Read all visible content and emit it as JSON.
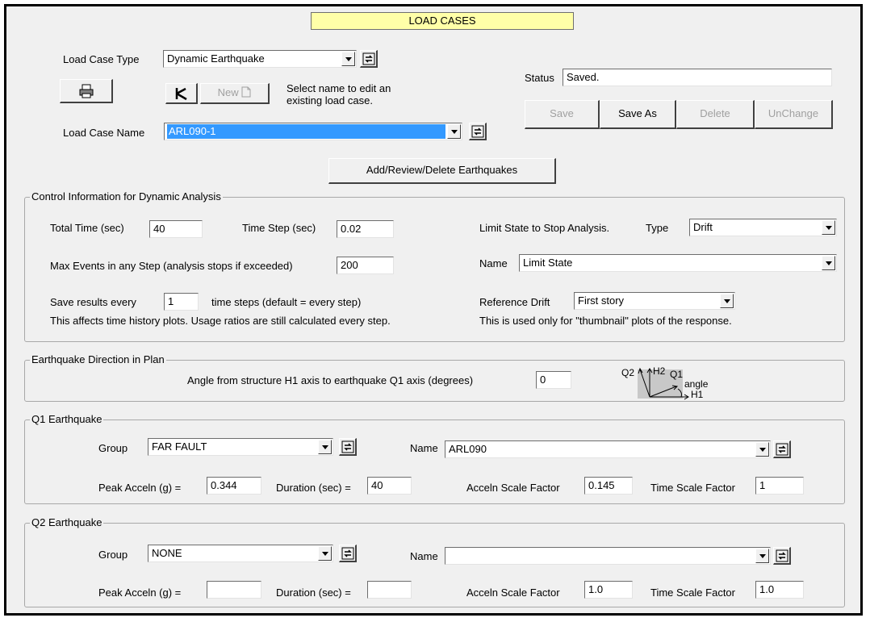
{
  "title": "LOAD CASES",
  "load_case_type": {
    "label": "Load Case Type",
    "value": "Dynamic Earthquake"
  },
  "load_case_name": {
    "label": "Load Case Name",
    "value": "ARL090-1"
  },
  "new_button": "New",
  "hint_text_1": "Select name to edit an",
  "hint_text_2": "existing load case.",
  "status": {
    "label": "Status",
    "value": "Saved."
  },
  "buttons": {
    "save": "Save",
    "save_as": "Save As",
    "delete": "Delete",
    "unchange": "UnChange",
    "earthquakes": "Add/Review/Delete Earthquakes"
  },
  "control": {
    "group_label": "Control Information for Dynamic Analysis",
    "total_time_label": "Total Time (sec)",
    "total_time": "40",
    "time_step_label": "Time Step (sec)",
    "time_step": "0.02",
    "max_events_label": "Max Events in any Step (analysis stops if exceeded)",
    "max_events": "200",
    "save_every_label": "Save results every",
    "save_every": "1",
    "time_steps_label": "time steps (default = every step)",
    "note_left": "This affects time history plots. Usage ratios are still calculated every step.",
    "limit_state_label": "Limit State to Stop Analysis.",
    "type_label": "Type",
    "type_value": "Drift",
    "name_label": "Name",
    "name_value": "Limit State",
    "ref_drift_label": "Reference Drift",
    "ref_drift_value": "First story",
    "note_right": "This is used only for \"thumbnail\" plots of the response."
  },
  "direction": {
    "group_label": "Earthquake Direction in Plan",
    "angle_label": "Angle from structure H1 axis to earthquake Q1 axis (degrees)",
    "angle_value": "0",
    "diagram": {
      "q2": "Q2",
      "h2": "H2",
      "q1": "Q1",
      "angle": "angle",
      "h1": "H1"
    }
  },
  "q1": {
    "group_label": "Q1 Earthquake",
    "group_field_label": "Group",
    "group_value": "FAR FAULT",
    "name_label": "Name",
    "name_value": "ARL090",
    "peak_label": "Peak Acceln (g) =",
    "peak_value": "0.344",
    "duration_label": "Duration (sec) =",
    "duration_value": "40",
    "acceln_sf_label": "Acceln Scale Factor",
    "acceln_sf_value": "0.145",
    "time_sf_label": "Time Scale Factor",
    "time_sf_value": "1"
  },
  "q2": {
    "group_label": "Q2 Earthquake",
    "group_field_label": "Group",
    "group_value": "NONE",
    "name_label": "Name",
    "name_value": "",
    "peak_label": "Peak Acceln (g) =",
    "peak_value": "",
    "duration_label": "Duration (sec) =",
    "duration_value": "",
    "acceln_sf_label": "Acceln Scale Factor",
    "acceln_sf_value": "1.0",
    "time_sf_label": "Time Scale Factor",
    "time_sf_value": "1.0"
  }
}
